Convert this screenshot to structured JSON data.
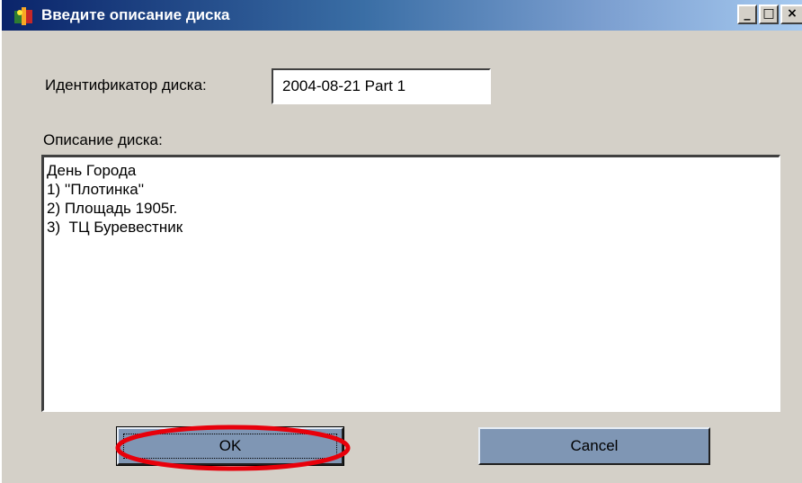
{
  "window": {
    "title": "Введите описание диска",
    "controls": {
      "minimize": "_",
      "maximize": "□",
      "close": "×"
    }
  },
  "form": {
    "disk_id_label": "Идентификатор диска:",
    "disk_id_value": "2004-08-21 Part 1",
    "description_label": "Описание диска:",
    "description_lines": [
      "День Города",
      "1) ''Плотинка''",
      "2) Площадь 1905г.",
      "3)  ТЦ Буревестник"
    ]
  },
  "buttons": {
    "ok_label": "OK",
    "cancel_label": "Cancel"
  },
  "annotation": {
    "highlight_color": "#e8000b"
  },
  "icons": {
    "app": "app-icon",
    "minimize": "minimize-icon",
    "maximize": "maximize-icon",
    "close": "close-icon"
  }
}
